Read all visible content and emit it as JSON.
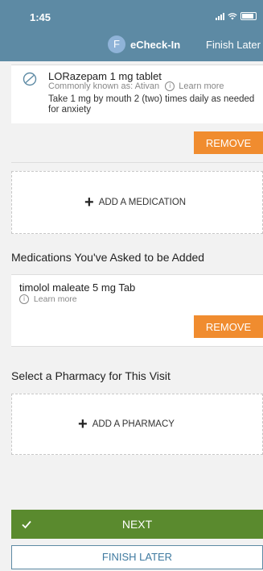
{
  "status_bar": {
    "time": "1:45"
  },
  "header": {
    "avatar_initial": "F",
    "title": "eCheck-In",
    "finish_later": "Finish Later"
  },
  "current_medication": {
    "name": "LORazepam 1 mg tablet",
    "known_as": "Commonly known as: Ativan",
    "learn_more": "Learn more",
    "instructions": "Take 1 mg by mouth 2 (two) times daily as needed for anxiety",
    "remove_label": "REMOVE"
  },
  "add_medication_label": "ADD A MEDICATION",
  "requested_section": {
    "title": "Medications You've Asked to be Added",
    "items": [
      {
        "name": "timolol maleate 5 mg Tab",
        "learn_more": "Learn more",
        "remove_label": "REMOVE"
      }
    ]
  },
  "pharmacy_section": {
    "title": "Select a Pharmacy for This Visit",
    "add_label": "ADD A PHARMACY"
  },
  "footer": {
    "next_label": "NEXT",
    "finish_later_label": "FINISH LATER"
  },
  "colors": {
    "header": "#5d8aa4",
    "remove": "#f08c2f",
    "next": "#5a8a2e",
    "finish_border": "#5d8aa4"
  }
}
